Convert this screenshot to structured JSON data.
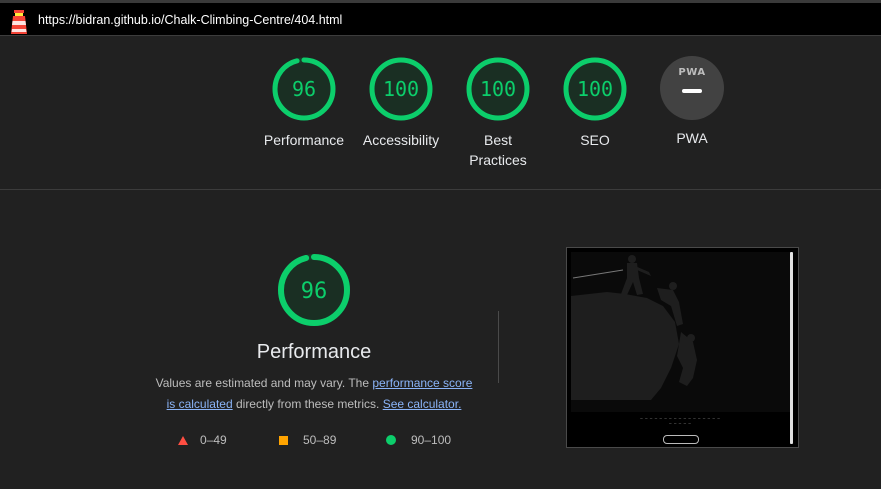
{
  "topbar": {
    "url": "https://bidran.github.io/Chalk-Climbing-Centre/404.html",
    "logo_icon": "lighthouse-icon"
  },
  "gauges": [
    {
      "label": "Performance",
      "score": "96",
      "value": 96,
      "color": "#0cce6b"
    },
    {
      "label": "Accessibility",
      "score": "100",
      "value": 100,
      "color": "#0cce6b"
    },
    {
      "label": "Best Practices",
      "score": "100",
      "value": 100,
      "color": "#0cce6b"
    },
    {
      "label": "SEO",
      "score": "100",
      "value": 100,
      "color": "#0cce6b"
    },
    {
      "label": "PWA",
      "badge": "PWA",
      "icon": "pwa-badge-icon"
    }
  ],
  "detail": {
    "score": "96",
    "value": 96,
    "title": "Performance",
    "desc_1": "Values are estimated and may vary. The ",
    "link_score": "performance score is calculated",
    "desc_2": " directly from these metrics. ",
    "link_calc": "See calculator."
  },
  "legend": [
    {
      "range": "0–49",
      "color": "#ff4e42",
      "icon": "triangle-icon"
    },
    {
      "range": "50–89",
      "color": "#ffa400",
      "icon": "square-icon"
    },
    {
      "range": "90–100",
      "color": "#0cce6b",
      "icon": "circle-icon"
    }
  ],
  "colors": {
    "background": "#212121",
    "pass": "#0cce6b",
    "link": "#8ab4f8"
  }
}
